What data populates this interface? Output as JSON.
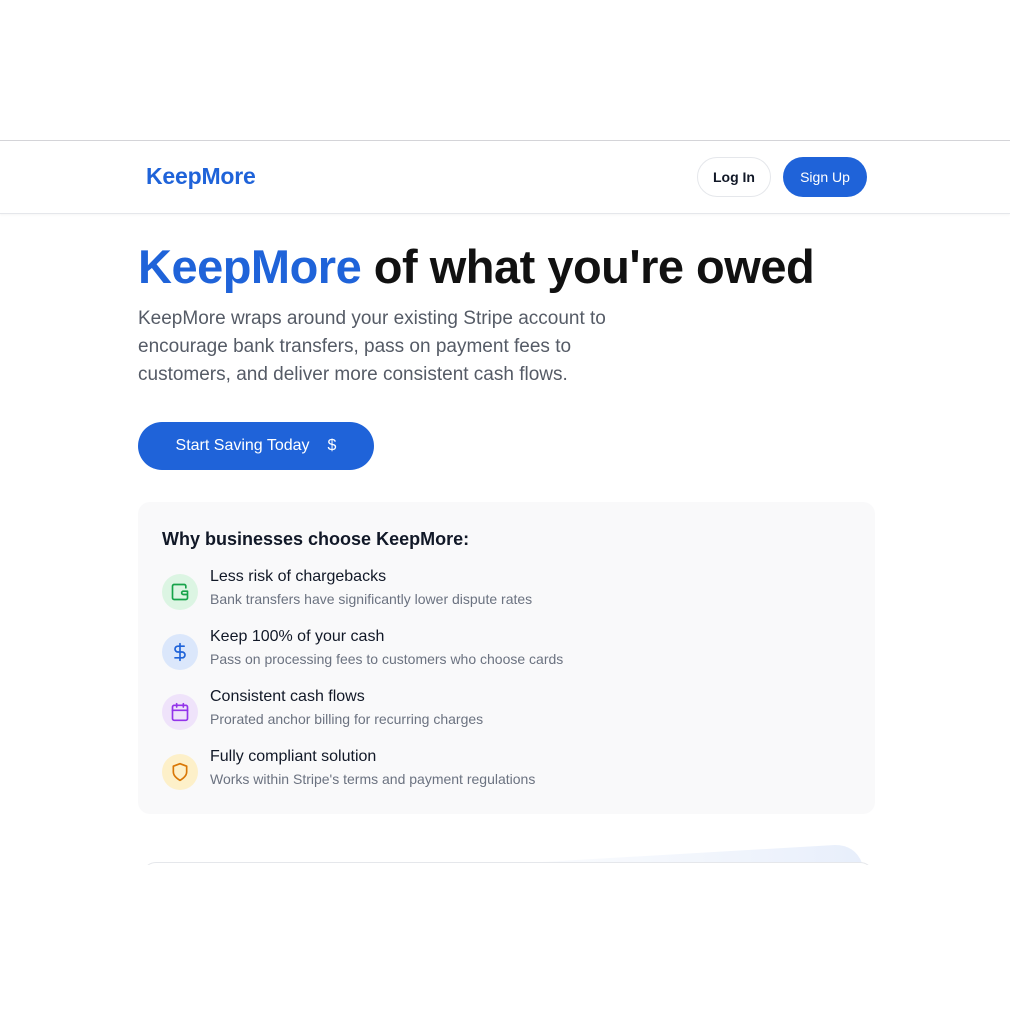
{
  "nav": {
    "logo": "KeepMore",
    "login_label": "Log In",
    "signup_label": "Sign Up"
  },
  "hero": {
    "title_brand": "KeepMore",
    "title_rest": "of what you're owed",
    "subtitle": "KeepMore wraps around your existing Stripe account to encourage bank transfers, pass on payment fees to customers, and deliver more consistent cash flows.",
    "cta_label": "Start Saving Today",
    "cta_icon": "$"
  },
  "features": {
    "heading": "Why businesses choose KeepMore:",
    "items": [
      {
        "title": "Less risk of chargebacks",
        "description": "Bank transfers have significantly lower dispute rates",
        "icon": "wallet-icon",
        "icon_bg": "#dcf5e3",
        "icon_color": "#16a34a"
      },
      {
        "title": "Keep 100% of your cash",
        "description": "Pass on processing fees to customers who choose cards",
        "icon": "dollar-icon",
        "icon_bg": "#dbe7fb",
        "icon_color": "#1f63d9"
      },
      {
        "title": "Consistent cash flows",
        "description": "Prorated anchor billing for recurring charges",
        "icon": "calendar-icon",
        "icon_bg": "#efe3fa",
        "icon_color": "#9333ea"
      },
      {
        "title": "Fully compliant solution",
        "description": "Works within Stripe's terms and payment regulations",
        "icon": "shield-icon",
        "icon_bg": "#fdf0c9",
        "icon_color": "#d97706"
      }
    ]
  },
  "colors": {
    "brand": "#1f63d9",
    "panel_bg": "#f9f9fa"
  }
}
